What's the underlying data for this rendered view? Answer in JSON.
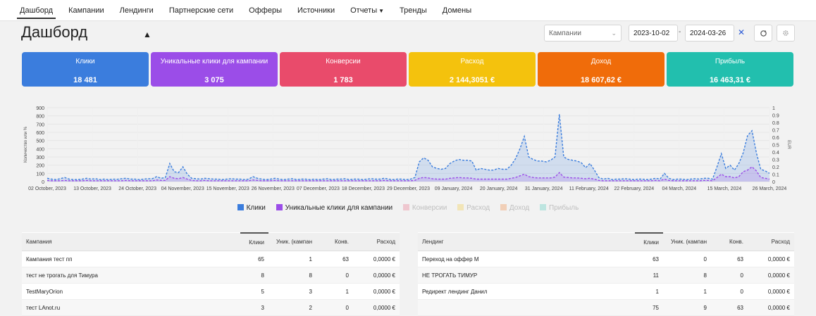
{
  "nav": {
    "items": [
      "Дашборд",
      "Кампании",
      "Лендинги",
      "Партнерские сети",
      "Офферы",
      "Источники",
      "Отчеты",
      "Тренды",
      "Домены"
    ]
  },
  "page": {
    "title": "Дашборд"
  },
  "filters": {
    "campaign_placeholder": "Кампании",
    "date_from": "2023-10-02",
    "date_to": "2024-03-26",
    "separator": "-"
  },
  "icons": {
    "refresh": "refresh-icon",
    "settings": "gear-icon",
    "clear": "close-icon",
    "chevron": "chevron-down-icon"
  },
  "cards": [
    {
      "label": "Клики",
      "value": "18 481",
      "color": "#3b7ddd"
    },
    {
      "label": "Уникальные клики для кампании",
      "value": "3 075",
      "color": "#9b4de8"
    },
    {
      "label": "Конверсии",
      "value": "1 783",
      "color": "#e94b6b"
    },
    {
      "label": "Расход",
      "value": "2 144,3051 €",
      "color": "#f4c20d"
    },
    {
      "label": "Доход",
      "value": "18 607,62 €",
      "color": "#f06c0a"
    },
    {
      "label": "Прибыль",
      "value": "16 463,31 €",
      "color": "#22bfae"
    }
  ],
  "chart_data": {
    "type": "area",
    "ylabel": "Количество или %",
    "y2label": "EUR",
    "ylim": [
      0,
      900
    ],
    "y2lim": [
      0,
      1.0
    ],
    "y_ticks": [
      0,
      100,
      200,
      300,
      400,
      500,
      600,
      700,
      800,
      900
    ],
    "y2_ticks": [
      0,
      0.1,
      0.2,
      0.3,
      0.4,
      0.5,
      0.6,
      0.7,
      0.8,
      0.9,
      1.0
    ],
    "x_ticks": [
      "02 October, 2023",
      "13 October, 2023",
      "24 October, 2023",
      "04 November, 2023",
      "15 November, 2023",
      "26 November, 2023",
      "07 December, 2023",
      "18 December, 2023",
      "29 December, 2023",
      "09 January, 2024",
      "20 January, 2024",
      "31 January, 2024",
      "11 February, 2024",
      "22 February, 2024",
      "04 March, 2024",
      "15 March, 2024",
      "26 March, 2024"
    ],
    "grid": true,
    "legend_position": "bottom",
    "series": [
      {
        "name": "Клики",
        "color": "#3b7ddd",
        "values": [
          40,
          30,
          25,
          35,
          50,
          30,
          25,
          25,
          30,
          40,
          30,
          35,
          25,
          30,
          25,
          30,
          28,
          35,
          40,
          30,
          30,
          25,
          30,
          35,
          35,
          60,
          40,
          50,
          220,
          120,
          110,
          180,
          90,
          40,
          35,
          30,
          40,
          35,
          30,
          30,
          25,
          30,
          35,
          30,
          30,
          25,
          30,
          60,
          40,
          30,
          25,
          30,
          40,
          30,
          25,
          30,
          35,
          25,
          30,
          30,
          25,
          30,
          25,
          30,
          35,
          25,
          30,
          30,
          35,
          25,
          30,
          30,
          25,
          30,
          35,
          30,
          30,
          40,
          30,
          25,
          30,
          30,
          25,
          30,
          50,
          240,
          290,
          260,
          180,
          160,
          150,
          160,
          220,
          250,
          270,
          260,
          260,
          250,
          140,
          160,
          150,
          140,
          140,
          160,
          150,
          150,
          200,
          280,
          400,
          550,
          300,
          270,
          250,
          250,
          240,
          260,
          300,
          820,
          300,
          270,
          260,
          250,
          230,
          170,
          220,
          140,
          50,
          30,
          40,
          25,
          30,
          30,
          35,
          30,
          25,
          30,
          30,
          25,
          30,
          40,
          30,
          100,
          40,
          25,
          30,
          30,
          25,
          30,
          35,
          30,
          40,
          40,
          30,
          180,
          340,
          160,
          200,
          140,
          220,
          350,
          560,
          620,
          350,
          150,
          130,
          100
        ]
      },
      {
        "name": "Уникальные клики для кампании",
        "color": "#9b4de8",
        "values": [
          15,
          10,
          10,
          10,
          15,
          10,
          10,
          10,
          10,
          15,
          10,
          10,
          10,
          10,
          10,
          10,
          10,
          10,
          15,
          10,
          10,
          10,
          10,
          10,
          10,
          20,
          15,
          15,
          60,
          40,
          35,
          50,
          30,
          15,
          10,
          10,
          15,
          10,
          10,
          10,
          10,
          10,
          10,
          10,
          10,
          10,
          10,
          20,
          15,
          10,
          10,
          10,
          15,
          10,
          10,
          10,
          10,
          10,
          10,
          10,
          10,
          10,
          10,
          10,
          10,
          10,
          10,
          10,
          10,
          10,
          10,
          10,
          10,
          10,
          10,
          10,
          10,
          15,
          10,
          10,
          10,
          10,
          10,
          10,
          15,
          40,
          50,
          45,
          35,
          30,
          30,
          30,
          40,
          45,
          50,
          45,
          45,
          40,
          30,
          30,
          30,
          30,
          30,
          30,
          30,
          30,
          40,
          50,
          70,
          90,
          60,
          50,
          45,
          45,
          45,
          45,
          55,
          110,
          55,
          50,
          45,
          45,
          40,
          35,
          40,
          30,
          15,
          10,
          10,
          10,
          10,
          10,
          10,
          10,
          10,
          10,
          10,
          10,
          10,
          15,
          10,
          30,
          15,
          10,
          10,
          10,
          10,
          10,
          10,
          10,
          15,
          15,
          10,
          50,
          90,
          60,
          60,
          45,
          60,
          120,
          140,
          180,
          130,
          50,
          40,
          30
        ]
      },
      {
        "name": "Конверсии",
        "color": "#e94b6b",
        "hidden": true,
        "values": []
      },
      {
        "name": "Расход",
        "color": "#f4c20d",
        "hidden": true,
        "values": []
      },
      {
        "name": "Доход",
        "color": "#f06c0a",
        "hidden": true,
        "values": []
      },
      {
        "name": "Прибыль",
        "color": "#22bfae",
        "hidden": true,
        "values": []
      }
    ]
  },
  "table_campaigns": {
    "headers": [
      "Кампания",
      "Клики",
      "Уник. (кампан",
      "Конв.",
      "Расход"
    ],
    "rows": [
      [
        "Кампания тест пп",
        "65",
        "1",
        "63",
        "0,0000 €"
      ],
      [
        "тест не трогать для Тимура",
        "8",
        "8",
        "0",
        "0,0000 €"
      ],
      [
        "TestMaryOrion",
        "5",
        "3",
        "1",
        "0,0000 €"
      ],
      [
        "тест LAnot.ru",
        "3",
        "2",
        "0",
        "0,0000 €"
      ]
    ]
  },
  "table_landings": {
    "headers": [
      "Лендинг",
      "Клики",
      "Уник. (кампан",
      "Конв.",
      "Расход"
    ],
    "rows": [
      [
        "Переход на оффер М",
        "63",
        "0",
        "63",
        "0,0000 €"
      ],
      [
        "НЕ ТРОГАТЬ ТИМУР",
        "11",
        "8",
        "0",
        "0,0000 €"
      ],
      [
        "Редирект лендинг Данил",
        "1",
        "1",
        "0",
        "0,0000 €"
      ],
      [
        "",
        "75",
        "9",
        "63",
        "0,0000 €"
      ]
    ]
  }
}
